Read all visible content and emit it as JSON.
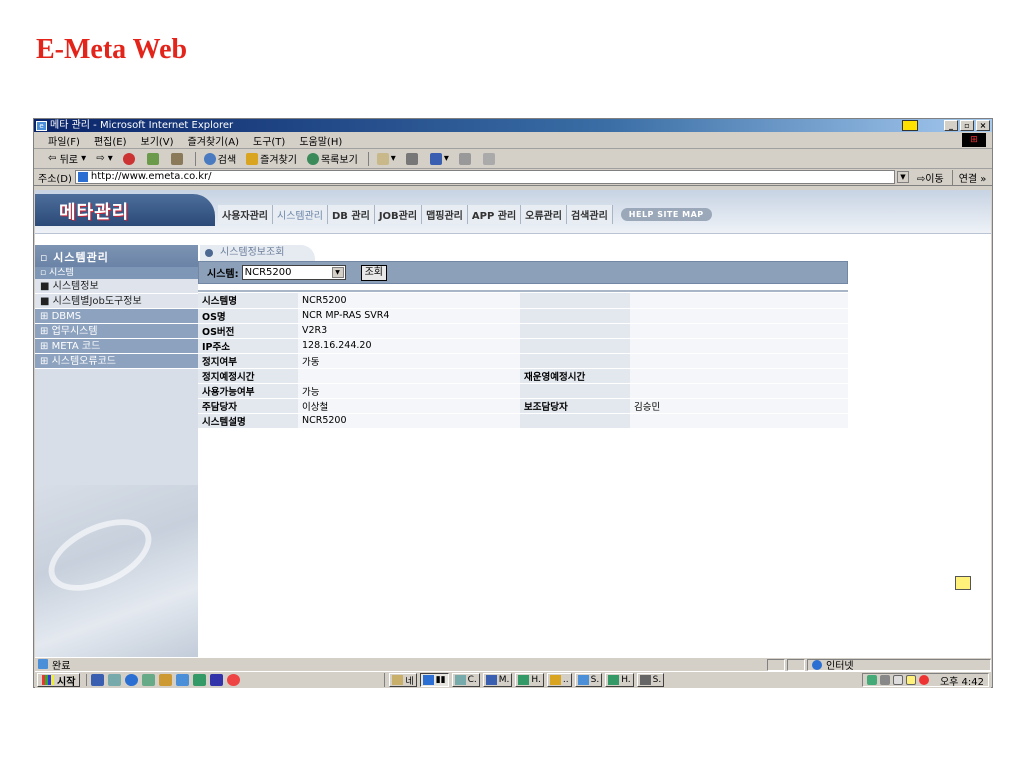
{
  "slide": {
    "title": "E-Meta Web"
  },
  "browser": {
    "title": "메타 관리 - Microsoft Internet Explorer",
    "menu": [
      "파일(F)",
      "편집(E)",
      "보기(V)",
      "즐겨찾기(A)",
      "도구(T)",
      "도움말(H)"
    ],
    "toolbar": {
      "back": "뒤로",
      "search": "검색",
      "favorites": "즐겨찾기",
      "history": "목록보기"
    },
    "address_label": "주소(D)",
    "address": "http://www.emeta.co.kr/",
    "go": "이동",
    "links": "연결 »",
    "status": "완료",
    "zone": "인터넷"
  },
  "site": {
    "logo": "메타관리",
    "nav": [
      "사용자관리",
      "시스템관리",
      "DB 관리",
      "JOB관리",
      "맵핑관리",
      "APP 관리",
      "오류관리",
      "검색관리"
    ],
    "nav_active_index": 1,
    "help": "HELP  SITE MAP"
  },
  "sidebar": {
    "header": "시스템관리",
    "sub": "시스템",
    "items": [
      "시스템정보",
      "시스템별Job도구정보",
      "DBMS",
      "업무시스템",
      "META 코드",
      "시스템오류코드"
    ],
    "item_markers": [
      "■",
      "■",
      "⊞",
      "⊞",
      "⊞",
      "⊞"
    ]
  },
  "content": {
    "tab": "시스템정보조회",
    "search_label": "시스템:",
    "system_value": "NCR5200",
    "search_button": "조회",
    "rows": [
      {
        "k": "시스템명",
        "v": "NCR5200",
        "k2": "",
        "v2": ""
      },
      {
        "k": "OS명",
        "v": "NCR MP-RAS SVR4",
        "k2": "",
        "v2": ""
      },
      {
        "k": "OS버전",
        "v": "V2R3",
        "k2": "",
        "v2": ""
      },
      {
        "k": "IP주소",
        "v": "128.16.244.20",
        "k2": "",
        "v2": ""
      },
      {
        "k": "정지여부",
        "v": "가동",
        "k2": "",
        "v2": ""
      },
      {
        "k": "정지예정시간",
        "v": "",
        "k2": "재운영예정시간",
        "v2": ""
      },
      {
        "k": "사용가능여부",
        "v": "가능",
        "k2": "",
        "v2": ""
      },
      {
        "k": "주담당자",
        "v": "이상철",
        "k2": "보조담당자",
        "v2": "김승민"
      },
      {
        "k": "시스템설명",
        "v": "NCR5200",
        "k2": "",
        "v2": ""
      }
    ]
  },
  "taskbar": {
    "start": "시작",
    "tasks": [
      "네",
      "",
      "C.",
      "M.",
      "H.",
      "..",
      "S.",
      "H.",
      "S."
    ],
    "clock": "오후 4:42"
  }
}
